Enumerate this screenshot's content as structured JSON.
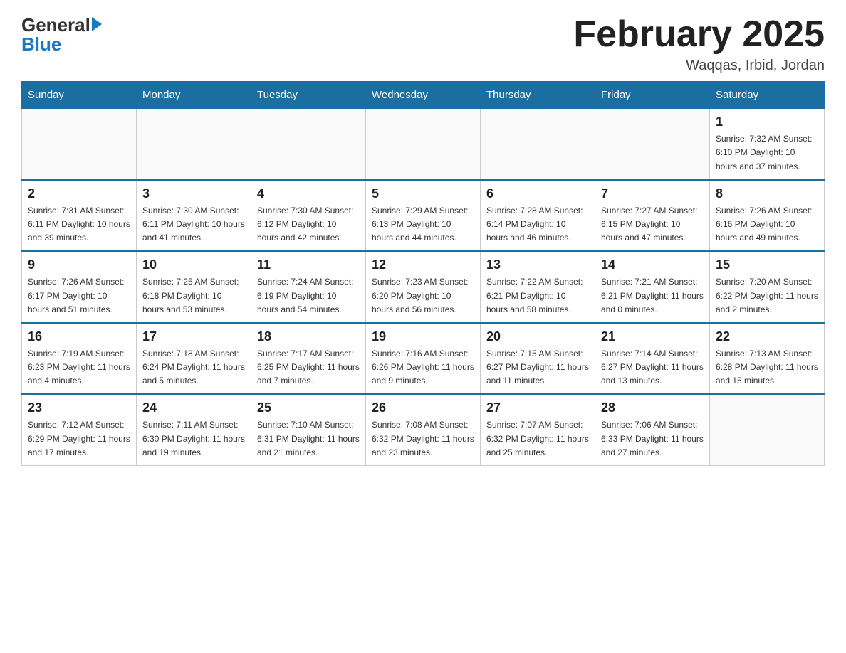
{
  "header": {
    "logo_general": "General",
    "logo_blue": "Blue",
    "title": "February 2025",
    "subtitle": "Waqqas, Irbid, Jordan"
  },
  "days_of_week": [
    "Sunday",
    "Monday",
    "Tuesday",
    "Wednesday",
    "Thursday",
    "Friday",
    "Saturday"
  ],
  "weeks": [
    [
      {
        "day": "",
        "info": ""
      },
      {
        "day": "",
        "info": ""
      },
      {
        "day": "",
        "info": ""
      },
      {
        "day": "",
        "info": ""
      },
      {
        "day": "",
        "info": ""
      },
      {
        "day": "",
        "info": ""
      },
      {
        "day": "1",
        "info": "Sunrise: 7:32 AM\nSunset: 6:10 PM\nDaylight: 10 hours and 37 minutes."
      }
    ],
    [
      {
        "day": "2",
        "info": "Sunrise: 7:31 AM\nSunset: 6:11 PM\nDaylight: 10 hours and 39 minutes."
      },
      {
        "day": "3",
        "info": "Sunrise: 7:30 AM\nSunset: 6:11 PM\nDaylight: 10 hours and 41 minutes."
      },
      {
        "day": "4",
        "info": "Sunrise: 7:30 AM\nSunset: 6:12 PM\nDaylight: 10 hours and 42 minutes."
      },
      {
        "day": "5",
        "info": "Sunrise: 7:29 AM\nSunset: 6:13 PM\nDaylight: 10 hours and 44 minutes."
      },
      {
        "day": "6",
        "info": "Sunrise: 7:28 AM\nSunset: 6:14 PM\nDaylight: 10 hours and 46 minutes."
      },
      {
        "day": "7",
        "info": "Sunrise: 7:27 AM\nSunset: 6:15 PM\nDaylight: 10 hours and 47 minutes."
      },
      {
        "day": "8",
        "info": "Sunrise: 7:26 AM\nSunset: 6:16 PM\nDaylight: 10 hours and 49 minutes."
      }
    ],
    [
      {
        "day": "9",
        "info": "Sunrise: 7:26 AM\nSunset: 6:17 PM\nDaylight: 10 hours and 51 minutes."
      },
      {
        "day": "10",
        "info": "Sunrise: 7:25 AM\nSunset: 6:18 PM\nDaylight: 10 hours and 53 minutes."
      },
      {
        "day": "11",
        "info": "Sunrise: 7:24 AM\nSunset: 6:19 PM\nDaylight: 10 hours and 54 minutes."
      },
      {
        "day": "12",
        "info": "Sunrise: 7:23 AM\nSunset: 6:20 PM\nDaylight: 10 hours and 56 minutes."
      },
      {
        "day": "13",
        "info": "Sunrise: 7:22 AM\nSunset: 6:21 PM\nDaylight: 10 hours and 58 minutes."
      },
      {
        "day": "14",
        "info": "Sunrise: 7:21 AM\nSunset: 6:21 PM\nDaylight: 11 hours and 0 minutes."
      },
      {
        "day": "15",
        "info": "Sunrise: 7:20 AM\nSunset: 6:22 PM\nDaylight: 11 hours and 2 minutes."
      }
    ],
    [
      {
        "day": "16",
        "info": "Sunrise: 7:19 AM\nSunset: 6:23 PM\nDaylight: 11 hours and 4 minutes."
      },
      {
        "day": "17",
        "info": "Sunrise: 7:18 AM\nSunset: 6:24 PM\nDaylight: 11 hours and 5 minutes."
      },
      {
        "day": "18",
        "info": "Sunrise: 7:17 AM\nSunset: 6:25 PM\nDaylight: 11 hours and 7 minutes."
      },
      {
        "day": "19",
        "info": "Sunrise: 7:16 AM\nSunset: 6:26 PM\nDaylight: 11 hours and 9 minutes."
      },
      {
        "day": "20",
        "info": "Sunrise: 7:15 AM\nSunset: 6:27 PM\nDaylight: 11 hours and 11 minutes."
      },
      {
        "day": "21",
        "info": "Sunrise: 7:14 AM\nSunset: 6:27 PM\nDaylight: 11 hours and 13 minutes."
      },
      {
        "day": "22",
        "info": "Sunrise: 7:13 AM\nSunset: 6:28 PM\nDaylight: 11 hours and 15 minutes."
      }
    ],
    [
      {
        "day": "23",
        "info": "Sunrise: 7:12 AM\nSunset: 6:29 PM\nDaylight: 11 hours and 17 minutes."
      },
      {
        "day": "24",
        "info": "Sunrise: 7:11 AM\nSunset: 6:30 PM\nDaylight: 11 hours and 19 minutes."
      },
      {
        "day": "25",
        "info": "Sunrise: 7:10 AM\nSunset: 6:31 PM\nDaylight: 11 hours and 21 minutes."
      },
      {
        "day": "26",
        "info": "Sunrise: 7:08 AM\nSunset: 6:32 PM\nDaylight: 11 hours and 23 minutes."
      },
      {
        "day": "27",
        "info": "Sunrise: 7:07 AM\nSunset: 6:32 PM\nDaylight: 11 hours and 25 minutes."
      },
      {
        "day": "28",
        "info": "Sunrise: 7:06 AM\nSunset: 6:33 PM\nDaylight: 11 hours and 27 minutes."
      },
      {
        "day": "",
        "info": ""
      }
    ]
  ]
}
